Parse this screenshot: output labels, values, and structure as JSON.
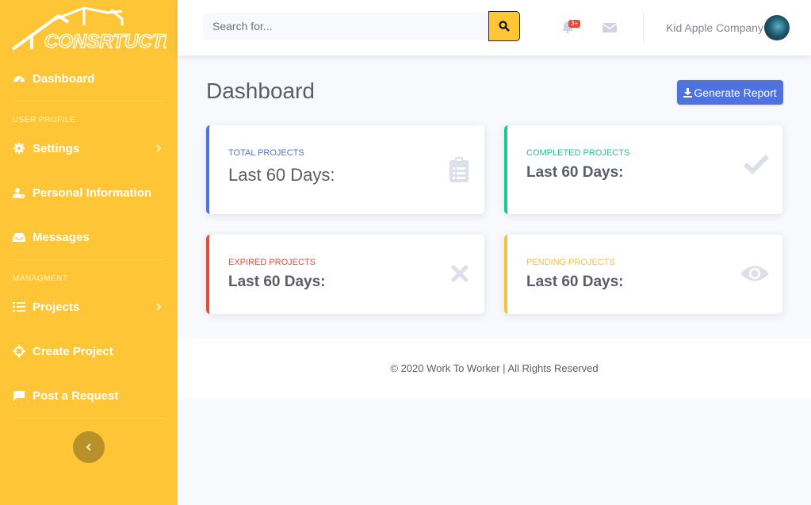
{
  "brand": {
    "name": "CONSRTUCTION"
  },
  "sidebar": {
    "items": [
      {
        "label": "Dashboard",
        "icon": "dashboard-icon"
      },
      {
        "label": "Settings",
        "icon": "gear-icon"
      },
      {
        "label": "Personal Information",
        "icon": "user-gear-icon"
      },
      {
        "label": "Messages",
        "icon": "inbox-icon"
      },
      {
        "label": "Projects",
        "icon": "tasks-icon"
      },
      {
        "label": "Create Project",
        "icon": "crosshairs-icon"
      },
      {
        "label": "Post a Request",
        "icon": "comment-icon"
      }
    ],
    "headings": [
      "USER PROFILE",
      "MANAGMENT"
    ]
  },
  "topbar": {
    "search_placeholder": "Search for...",
    "alerts_badge": "3+",
    "user_name": "Kid Apple Company"
  },
  "main": {
    "title": "Dashboard",
    "report_button": "Generate Report",
    "cards": [
      {
        "caption": "TOTAL PROJECTS",
        "value": "Last 60 Days:",
        "color": "#4e73df",
        "icon": "clipboard-list-icon"
      },
      {
        "caption": "COMPLETED PROJECTS",
        "value": "Last 60 Days:",
        "color": "#1cc88a",
        "icon": "check-icon"
      },
      {
        "caption": "EXPIRED PROJECTS",
        "value": "Last 60 Days:",
        "color": "#e74a3b",
        "icon": "times-icon"
      },
      {
        "caption": "PENDING PROJECTS",
        "value": "Last 60 Days:",
        "color": "#f6c23e",
        "icon": "eye-icon"
      }
    ]
  },
  "footer": {
    "text": "© 2020 Work To Worker | All Rights Reserved"
  },
  "colors": {
    "sidebar": "#fec637",
    "primary": "#4e73df"
  }
}
